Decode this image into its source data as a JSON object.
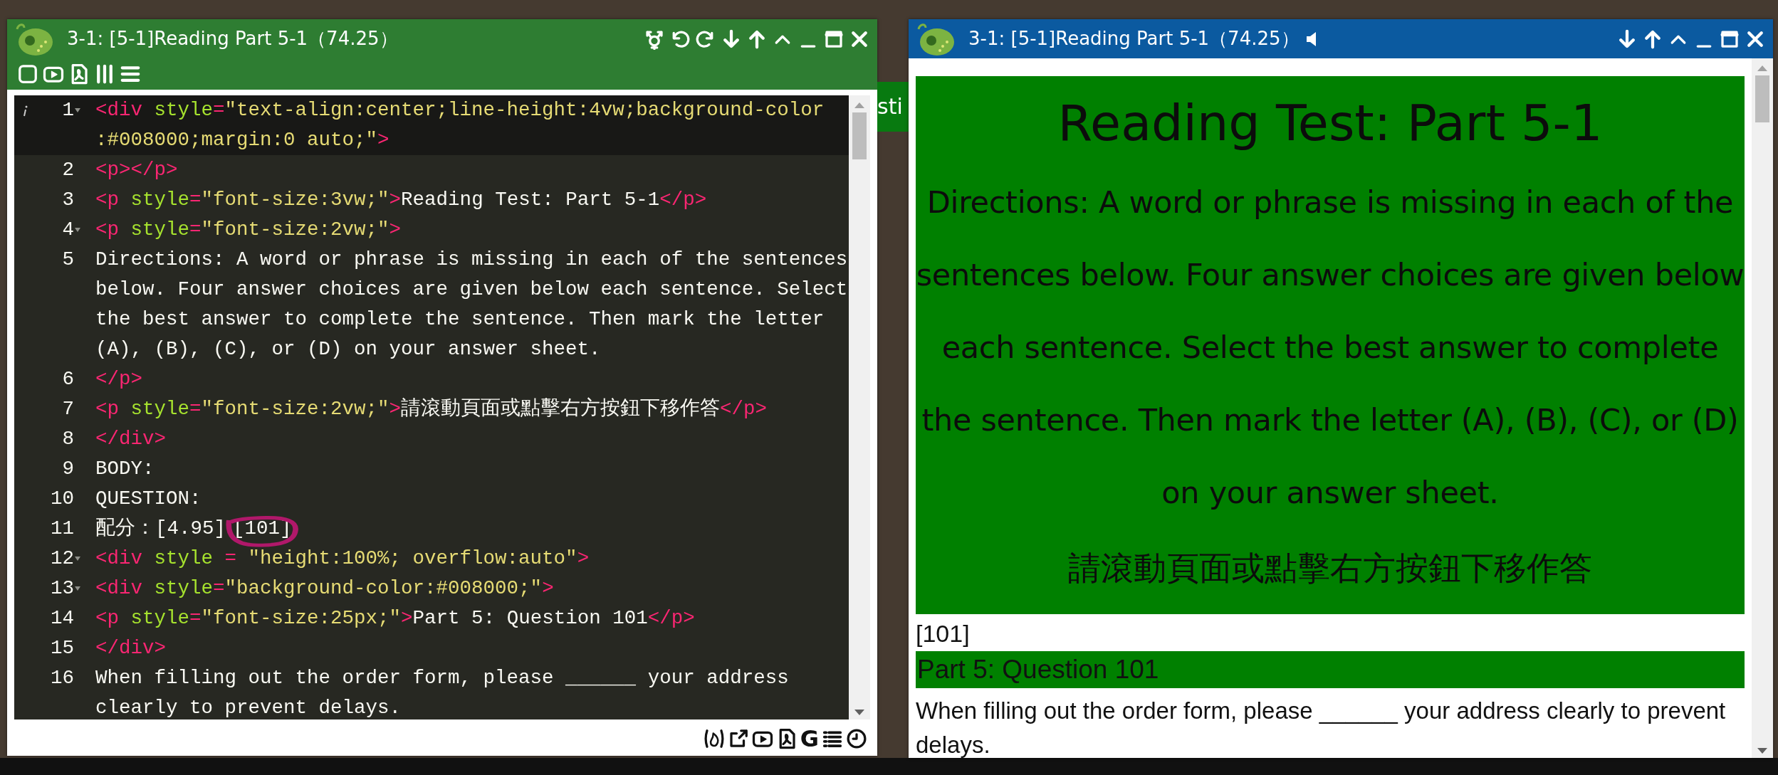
{
  "left_window": {
    "title": "3-1: [5-1]Reading Part 5-1（74.25）",
    "editor": {
      "lines": [
        {
          "number": "1",
          "fold": true,
          "active": true,
          "rows": [
            {
              "tokens": [
                {
                  "kind": "tag",
                  "text": "<div "
                },
                {
                  "kind": "attr",
                  "text": "style"
                },
                {
                  "kind": "tag",
                  "text": "="
                },
                {
                  "kind": "string",
                  "text": "\"text-align:center;line-height:4vw;background-color"
                }
              ]
            },
            {
              "tokens": [
                {
                  "kind": "string",
                  "text": ":#008000;margin:0 auto;\""
                },
                {
                  "kind": "tag",
                  "text": ">"
                }
              ]
            }
          ]
        },
        {
          "number": "2",
          "fold": false,
          "active": false,
          "rows": [
            {
              "tokens": [
                {
                  "kind": "tag",
                  "text": "<p></p>"
                }
              ]
            }
          ]
        },
        {
          "number": "3",
          "fold": false,
          "active": false,
          "rows": [
            {
              "tokens": [
                {
                  "kind": "tag",
                  "text": "<p "
                },
                {
                  "kind": "attr",
                  "text": "style"
                },
                {
                  "kind": "tag",
                  "text": "="
                },
                {
                  "kind": "string",
                  "text": "\"font-size:3vw;\""
                },
                {
                  "kind": "tag",
                  "text": ">"
                },
                {
                  "kind": "text",
                  "text": "Reading Test: Part 5-1"
                },
                {
                  "kind": "tag",
                  "text": "</p>"
                }
              ]
            }
          ]
        },
        {
          "number": "4",
          "fold": true,
          "active": false,
          "rows": [
            {
              "tokens": [
                {
                  "kind": "tag",
                  "text": "<p "
                },
                {
                  "kind": "attr",
                  "text": "style"
                },
                {
                  "kind": "tag",
                  "text": "="
                },
                {
                  "kind": "string",
                  "text": "\"font-size:2vw;\""
                },
                {
                  "kind": "tag",
                  "text": ">"
                }
              ]
            }
          ]
        },
        {
          "number": "5",
          "fold": false,
          "active": false,
          "rows": [
            {
              "tokens": [
                {
                  "kind": "text",
                  "text": "Directions: A word or phrase is missing in each of the sentences"
                }
              ]
            },
            {
              "tokens": [
                {
                  "kind": "text",
                  "text": "below. Four answer choices are given below each sentence. Select"
                }
              ]
            },
            {
              "tokens": [
                {
                  "kind": "text",
                  "text": "the best answer to complete the sentence. Then mark the letter"
                }
              ]
            },
            {
              "tokens": [
                {
                  "kind": "text",
                  "text": "(A), (B), (C), or (D) on your answer sheet."
                }
              ]
            }
          ]
        },
        {
          "number": "6",
          "fold": false,
          "active": false,
          "rows": [
            {
              "tokens": [
                {
                  "kind": "tag",
                  "text": "</p>"
                }
              ]
            }
          ]
        },
        {
          "number": "7",
          "fold": false,
          "active": false,
          "rows": [
            {
              "tokens": [
                {
                  "kind": "tag",
                  "text": "<p "
                },
                {
                  "kind": "attr",
                  "text": "style"
                },
                {
                  "kind": "tag",
                  "text": "="
                },
                {
                  "kind": "string",
                  "text": "\"font-size:2vw;\""
                },
                {
                  "kind": "tag",
                  "text": ">"
                },
                {
                  "kind": "text",
                  "text": "請滾動頁面或點擊右方按鈕下移作答"
                },
                {
                  "kind": "tag",
                  "text": "</p>"
                }
              ]
            }
          ]
        },
        {
          "number": "8",
          "fold": false,
          "active": false,
          "rows": [
            {
              "tokens": [
                {
                  "kind": "tag",
                  "text": "</div>"
                }
              ]
            }
          ]
        },
        {
          "number": "9",
          "fold": false,
          "active": false,
          "rows": [
            {
              "tokens": [
                {
                  "kind": "text",
                  "text": "BODY:"
                }
              ]
            }
          ]
        },
        {
          "number": "10",
          "fold": false,
          "active": false,
          "rows": [
            {
              "tokens": [
                {
                  "kind": "text",
                  "text": "QUESTION:"
                }
              ]
            }
          ]
        },
        {
          "number": "11",
          "fold": false,
          "active": false,
          "rows": [
            {
              "tokens": [
                {
                  "kind": "text",
                  "text": "配分：[4.95]",
                  "circled": false
                },
                {
                  "kind": "text",
                  "text": "[101]",
                  "circled": true
                }
              ]
            }
          ]
        },
        {
          "number": "12",
          "fold": true,
          "active": false,
          "rows": [
            {
              "tokens": [
                {
                  "kind": "tag",
                  "text": "<div "
                },
                {
                  "kind": "attr",
                  "text": "style"
                },
                {
                  "kind": "tag",
                  "text": " = "
                },
                {
                  "kind": "string",
                  "text": "\"height:100%; overflow:auto\""
                },
                {
                  "kind": "tag",
                  "text": ">"
                }
              ]
            }
          ]
        },
        {
          "number": "13",
          "fold": true,
          "active": false,
          "rows": [
            {
              "tokens": [
                {
                  "kind": "tag",
                  "text": "<div "
                },
                {
                  "kind": "attr",
                  "text": "style"
                },
                {
                  "kind": "tag",
                  "text": "="
                },
                {
                  "kind": "string",
                  "text": "\"background-color:#008000;\""
                },
                {
                  "kind": "tag",
                  "text": ">"
                }
              ]
            }
          ]
        },
        {
          "number": "14",
          "fold": false,
          "active": false,
          "rows": [
            {
              "tokens": [
                {
                  "kind": "tag",
                  "text": "<p "
                },
                {
                  "kind": "attr",
                  "text": "style"
                },
                {
                  "kind": "tag",
                  "text": "="
                },
                {
                  "kind": "string",
                  "text": "\"font-size:25px;\""
                },
                {
                  "kind": "tag",
                  "text": ">"
                },
                {
                  "kind": "text",
                  "text": "Part 5: Question 101"
                },
                {
                  "kind": "tag",
                  "text": "</p>"
                }
              ]
            }
          ]
        },
        {
          "number": "15",
          "fold": false,
          "active": false,
          "rows": [
            {
              "tokens": [
                {
                  "kind": "tag",
                  "text": "</div>"
                }
              ]
            }
          ]
        },
        {
          "number": "16",
          "fold": false,
          "active": false,
          "rows": [
            {
              "tokens": [
                {
                  "kind": "text",
                  "text": "When filling out the order form, please ______ your address"
                }
              ]
            },
            {
              "tokens": [
                {
                  "kind": "text",
                  "text": "clearly to prevent delays."
                }
              ]
            }
          ]
        }
      ]
    },
    "bottom_toolbar": {
      "letter_button": "G"
    }
  },
  "background_window": {
    "text": "sti"
  },
  "right_window": {
    "title": "3-1: [5-1]Reading Part 5-1（74.25）",
    "banner": {
      "heading": "Reading Test: Part 5-1",
      "directions": "Directions: A word or phrase is missing in each of the sentences below. Four answer choices are given below each sentence. Select the best answer to complete the sentence. Then mark the letter (A), (B), (C), or (D) on your answer sheet.",
      "instruction": "請滾動頁面或點擊右方按鈕下移作答"
    },
    "question_id": "[101]",
    "question_heading": "Part 5: Question 101",
    "question_text": "When filling out the order form, please ______ your address clearly to prevent delays."
  }
}
